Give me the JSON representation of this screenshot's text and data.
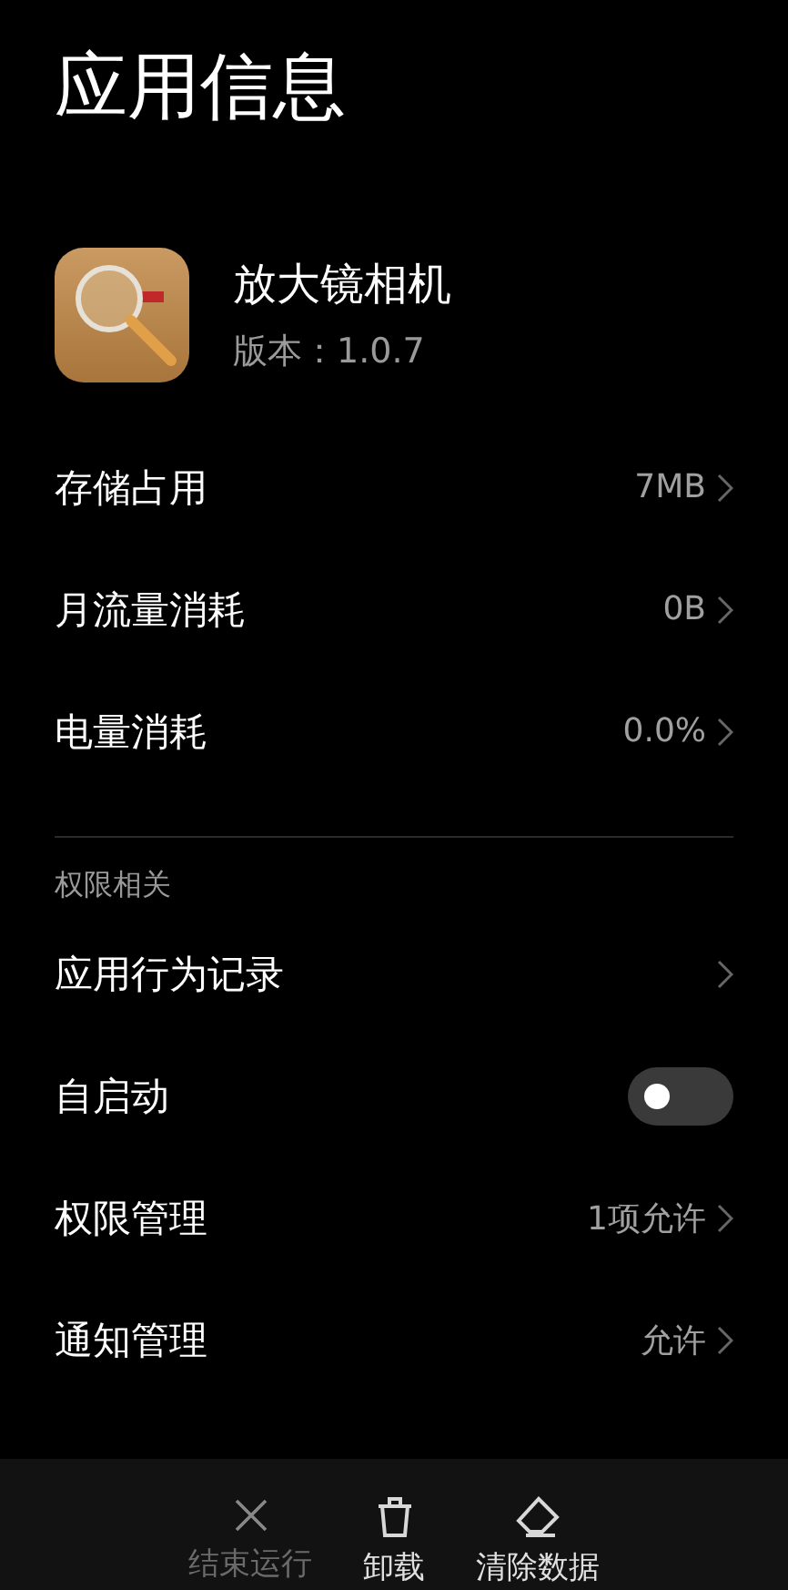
{
  "title": "应用信息",
  "app": {
    "name": "放大镜相机",
    "version": "版本：1.0.7"
  },
  "usage": [
    {
      "kind": "link",
      "label": "存储占用",
      "value": "7MB"
    },
    {
      "kind": "link",
      "label": "月流量消耗",
      "value": "0B"
    },
    {
      "kind": "link",
      "label": "电量消耗",
      "value": "0.0%"
    }
  ],
  "permissions": {
    "heading": "权限相关",
    "items": [
      {
        "kind": "link",
        "label": "应用行为记录"
      },
      {
        "kind": "toggle",
        "label": "自启动",
        "on": false
      },
      {
        "kind": "link",
        "label": "权限管理",
        "value": "1项允许"
      },
      {
        "kind": "link",
        "label": "通知管理",
        "value": "允许"
      }
    ]
  },
  "actions": [
    {
      "kind": "close",
      "label": "结束运行",
      "disabled": true
    },
    {
      "kind": "trash",
      "label": "卸载",
      "disabled": false
    },
    {
      "kind": "eraser",
      "label": "清除数据",
      "disabled": false
    }
  ]
}
